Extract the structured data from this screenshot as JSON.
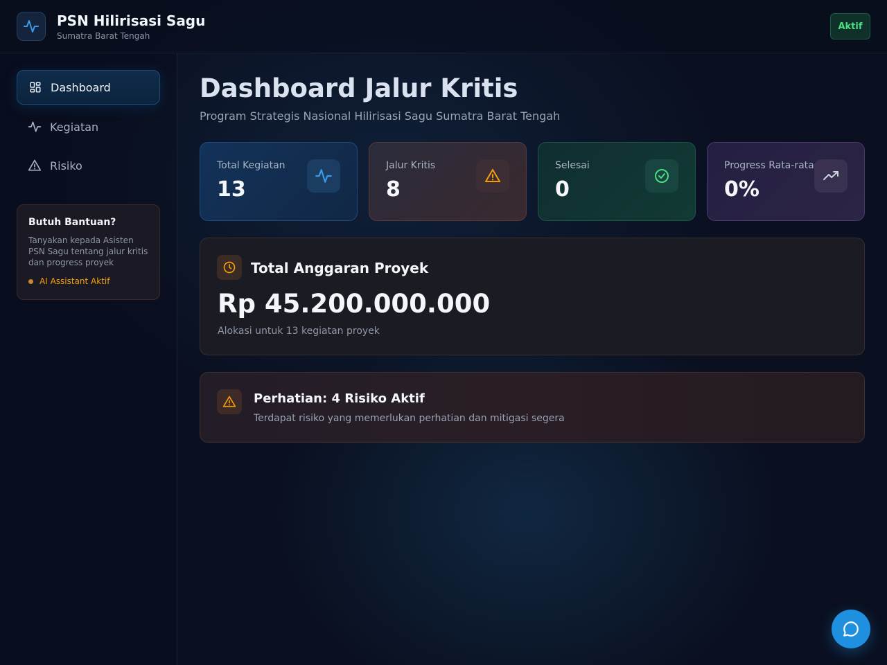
{
  "header": {
    "title": "PSN Hilirisasi Sagu",
    "subtitle": "Sumatra Barat Tengah",
    "status": "Aktif"
  },
  "sidebar": {
    "items": [
      {
        "label": "Dashboard",
        "icon": "grid-icon",
        "active": true
      },
      {
        "label": "Kegiatan",
        "icon": "activity-icon",
        "active": false
      },
      {
        "label": "Risiko",
        "icon": "warning-icon",
        "active": false
      }
    ],
    "help": {
      "title": "Butuh Bantuan?",
      "text": "Tanyakan kepada Asisten PSN Sagu tentang jalur kritis dan progress proyek",
      "status": "AI Assistant Aktif"
    }
  },
  "main": {
    "title": "Dashboard Jalur Kritis",
    "subtitle": "Program Strategis Nasional Hilirisasi Sagu Sumatra Barat Tengah",
    "stats": [
      {
        "label": "Total Kegiatan",
        "value": "13",
        "icon": "activity-icon",
        "color": "#3b9be8"
      },
      {
        "label": "Jalur Kritis",
        "value": "8",
        "icon": "warning-icon",
        "color": "#f59e0b"
      },
      {
        "label": "Selesai",
        "value": "0",
        "icon": "check-circle-icon",
        "color": "#4ade80"
      },
      {
        "label": "Progress Rata-rata",
        "value": "0%",
        "icon": "trending-up-icon",
        "color": "#cbd5e1"
      }
    ],
    "budget": {
      "title": "Total Anggaran Proyek",
      "value": "Rp 45.200.000.000",
      "note": "Alokasi untuk 13 kegiatan proyek",
      "icon": "clock-icon"
    },
    "risk": {
      "title": "Perhatian: 4 Risiko Aktif",
      "text": "Terdapat risiko yang memerlukan perhatian dan mitigasi segera",
      "icon": "warning-icon"
    }
  },
  "chat": {
    "icon": "chat-bubble-icon"
  }
}
